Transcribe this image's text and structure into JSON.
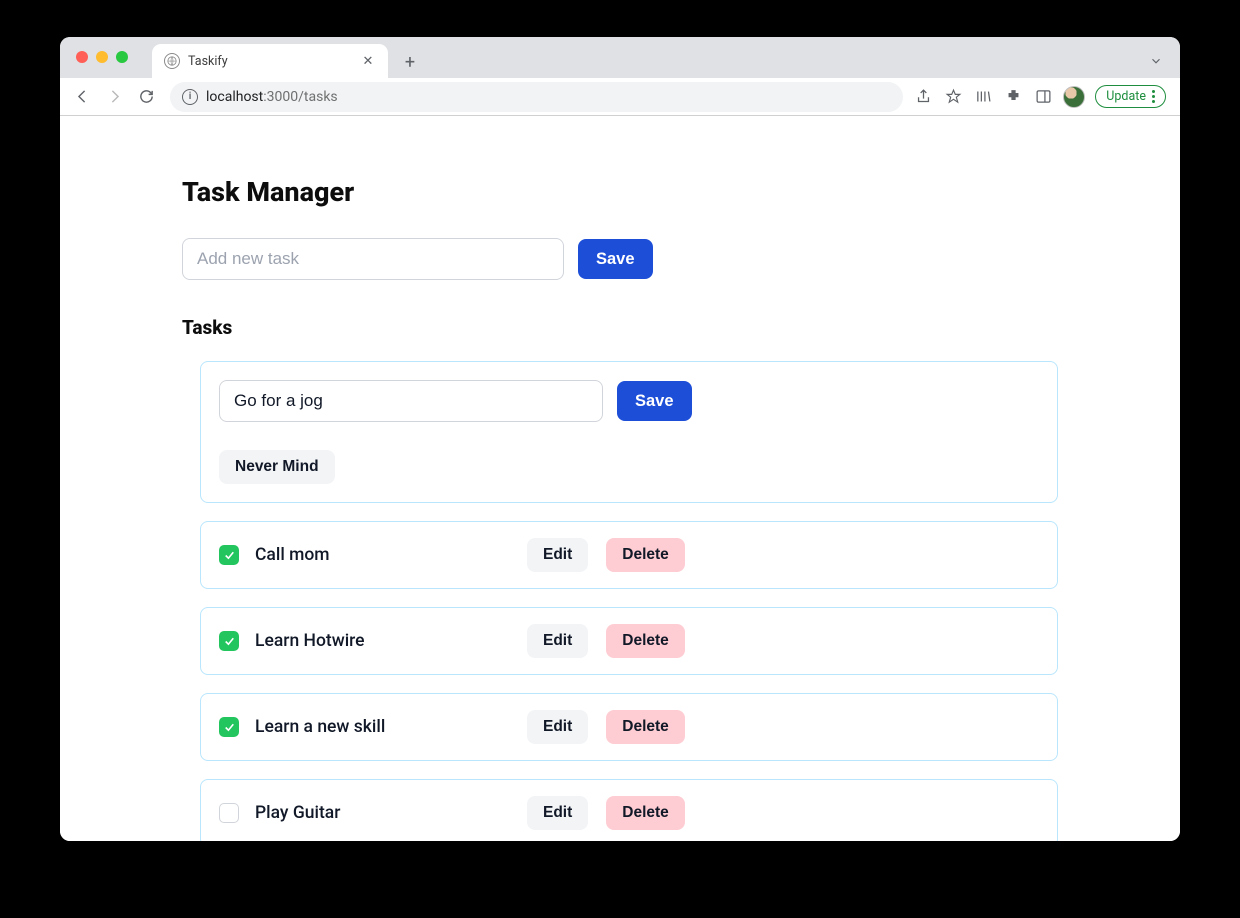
{
  "browser": {
    "tab_title": "Taskify",
    "url_host": "localhost",
    "url_port": ":3000",
    "url_path": "/tasks",
    "update_label": "Update"
  },
  "page": {
    "title": "Task Manager",
    "new_task_placeholder": "Add new task",
    "save_label": "Save",
    "tasks_heading": "Tasks",
    "edit_form": {
      "value": "Go for a jog",
      "save_label": "Save",
      "cancel_label": "Never Mind"
    },
    "task_buttons": {
      "edit": "Edit",
      "delete": "Delete"
    },
    "tasks": [
      {
        "name": "Call mom",
        "completed": true
      },
      {
        "name": "Learn Hotwire",
        "completed": true
      },
      {
        "name": "Learn a new skill",
        "completed": true
      },
      {
        "name": "Play Guitar",
        "completed": false
      }
    ]
  }
}
